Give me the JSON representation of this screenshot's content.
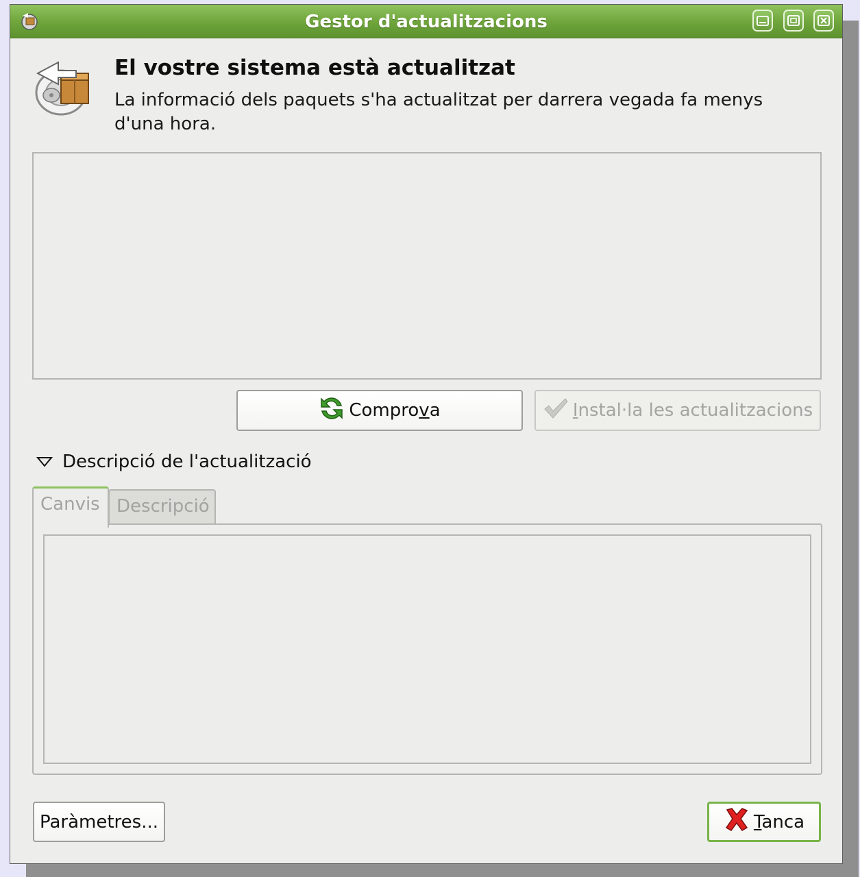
{
  "window": {
    "title": "Gestor d'actualitzacions",
    "icons": {
      "app": "update-manager-icon",
      "minimize": "minimize-icon",
      "maximize": "maximize-icon",
      "close": "close-icon"
    }
  },
  "header": {
    "icon": "package-update-icon",
    "title": "El vostre sistema està actualitzat",
    "subtitle": "La informació dels paquets s'ha actualitzat per darrera vegada fa menys d'una hora."
  },
  "actions": {
    "check": {
      "pre": "Compro",
      "mnemonic": "v",
      "post": "a",
      "icon": "refresh-icon"
    },
    "install": {
      "pre": "",
      "mnemonic": "I",
      "post": "nstal·la les actualitzacions",
      "icon": "check-icon",
      "enabled": false
    }
  },
  "details": {
    "expander_label": "Descripció de l'actualització",
    "expanded": true,
    "tabs": [
      {
        "label": "Canvis",
        "active": true
      },
      {
        "label": "Descripció",
        "active": false
      }
    ]
  },
  "footer": {
    "settings_label": "Paràmetres...",
    "close": {
      "pre": "",
      "mnemonic": "T",
      "post": "anca",
      "icon": "close-red-x-icon"
    }
  },
  "colors": {
    "titlebar": "#6ea43a",
    "accent": "#78b348",
    "background": "#edeeeb",
    "desktop": "#e6e6f8"
  }
}
